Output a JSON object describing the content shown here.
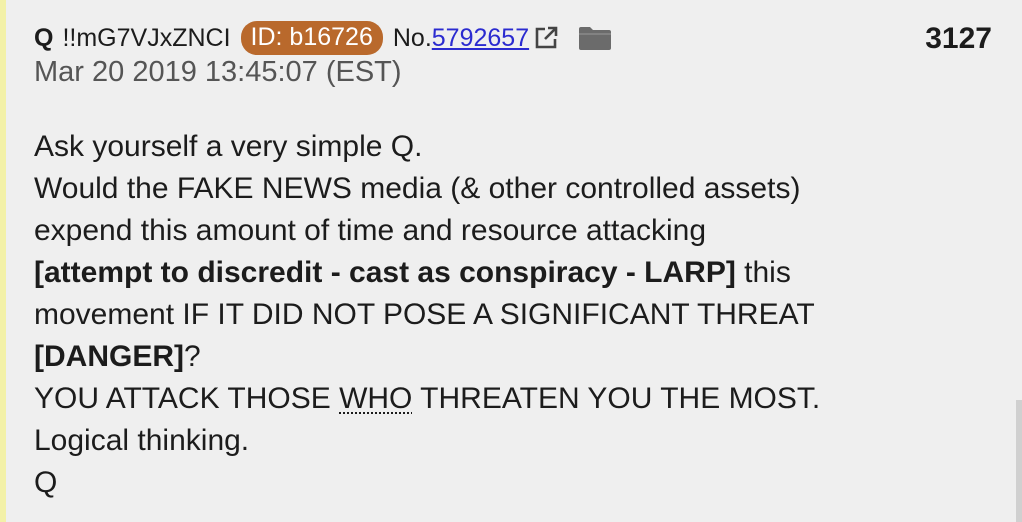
{
  "post": {
    "name": "Q",
    "tripcode": "!!mG7VJxZNCI",
    "id_badge": "ID: b16726",
    "no_label": "No.",
    "post_number": "5792657",
    "count": "3127",
    "date": "Mar 20 2019 13:45:07 (EST)",
    "body": {
      "line1": "Ask yourself a very simple Q.",
      "line2": "Would the FAKE NEWS media (& other controlled assets)",
      "line3": "expend this amount of time and resource attacking",
      "line4_bold": "[attempt to discredit - cast as conspiracy - LARP]",
      "line4_rest": " this",
      "line5": "movement IF IT DID NOT POSE A SIGNIFICANT THREAT",
      "line6_bold": "[DANGER]",
      "line6_rest": "?",
      "line7_a": "YOU ATTACK THOSE ",
      "line7_underlined": "WHO",
      "line7_b": " THREATEN YOU THE MOST.",
      "line8": "Logical thinking.",
      "line9": "Q"
    }
  },
  "colors": {
    "background": "#efefef",
    "id_badge": "#b9692c",
    "link": "#2b2bd0",
    "left_border": "#f3f1a8"
  },
  "icons": {
    "external_link": "external-link-icon",
    "folder": "folder-icon"
  }
}
